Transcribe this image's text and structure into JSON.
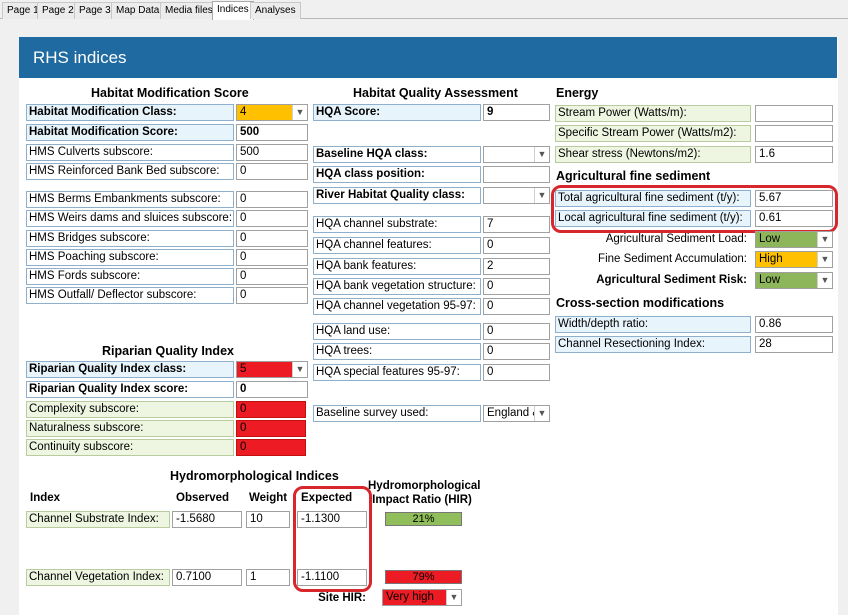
{
  "tabs": [
    "Page 1",
    "Page 2",
    "Page 3",
    "Map Data",
    "Media files",
    "Indices",
    "Analyses"
  ],
  "active_tab": "Indices",
  "header": {
    "title": "RHS indices"
  },
  "hms": {
    "title": "Habitat Modification Score",
    "class_label": "Habitat Modification Class:",
    "class_value": "4",
    "score_label": "Habitat Modification Score:",
    "score_value": "500",
    "rows": [
      {
        "label": "HMS Culverts subscore:",
        "value": "500"
      },
      {
        "label": "HMS Reinforced Bank Bed subscore:",
        "value": "0"
      },
      {
        "label": "HMS Berms Embankments subscore:",
        "value": "0"
      },
      {
        "label": "HMS Weirs dams and sluices subscore:",
        "value": "0"
      },
      {
        "label": "HMS Bridges subscore:",
        "value": "0"
      },
      {
        "label": "HMS Poaching subscore:",
        "value": "0"
      },
      {
        "label": "HMS Fords subscore:",
        "value": "0"
      },
      {
        "label": "HMS Outfall/ Deflector subscore:",
        "value": "0"
      }
    ]
  },
  "rqi": {
    "title": "Riparian Quality Index",
    "class_label": "Riparian Quality Index class:",
    "class_value": "5",
    "score_label": "Riparian Quality Index score:",
    "score_value": "0",
    "rows": [
      {
        "label": "Complexity subscore:",
        "value": "0"
      },
      {
        "label": "Naturalness subscore:",
        "value": "0"
      },
      {
        "label": "Continuity subscore:",
        "value": "0"
      }
    ]
  },
  "hqa": {
    "title": "Habitat Quality Assessment",
    "score_label": "HQA Score:",
    "score_value": "9",
    "baseline_class_label": "Baseline HQA class:",
    "class_position_label": "HQA class position:",
    "river_class_label": "River Habitat Quality class:",
    "rows": [
      {
        "label": "HQA channel substrate:",
        "value": "7"
      },
      {
        "label": "HQA channel features:",
        "value": "0"
      },
      {
        "label": "HQA bank features:",
        "value": "2"
      },
      {
        "label": "HQA bank vegetation structure:",
        "value": "0"
      },
      {
        "label": "HQA channel vegetation 95-97:",
        "value": "0"
      },
      {
        "label": "HQA land use:",
        "value": "0"
      },
      {
        "label": "HQA trees:",
        "value": "0"
      },
      {
        "label": "HQA special features 95-97:",
        "value": "0"
      }
    ],
    "baseline_survey_label": "Baseline survey used:",
    "baseline_survey_value": "England &"
  },
  "energy": {
    "title": "Energy",
    "rows": [
      {
        "label": "Stream Power (Watts/m):",
        "value": ""
      },
      {
        "label": "Specific Stream Power (Watts/m2):",
        "value": ""
      },
      {
        "label": "Shear stress (Newtons/m2):",
        "value": "1.6"
      }
    ]
  },
  "sediment": {
    "title": "Agricultural fine sediment",
    "total_label": "Total agricultural fine sediment (t/y):",
    "total_value": "5.67",
    "local_label": "Local agricultural fine sediment (t/y):",
    "local_value": "0.61",
    "load_label": "Agricultural Sediment Load:",
    "load_value": "Low",
    "accum_label": "Fine Sediment Accumulation:",
    "accum_value": "High",
    "risk_label": "Agricultural Sediment Risk:",
    "risk_value": "Low"
  },
  "xsec": {
    "title": "Cross-section modifications",
    "wd_label": "Width/depth ratio:",
    "wd_value": "0.86",
    "cri_label": "Channel Resectioning Index:",
    "cri_value": "28"
  },
  "hydro": {
    "title": "Hydromorphological Indices",
    "col_index": "Index",
    "col_observed": "Observed",
    "col_weight": "Weight",
    "col_expected": "Expected",
    "col_hir": "Hydromorphological Impact Ratio (HIR)",
    "rows": [
      {
        "label": "Channel Substrate Index:",
        "observed": "-1.5680",
        "weight": "10",
        "expected": "-1.1300",
        "hir": "21%"
      },
      {
        "label": "Channel Vegetation Index:",
        "observed": "0.7100",
        "weight": "1",
        "expected": "-1.1100",
        "hir": "79%"
      }
    ],
    "site_hir_label": "Site HIR:",
    "site_hir_value": "Very high"
  },
  "colors": {
    "header": "#1f6aa0",
    "orange": "#ffc000",
    "red": "#ed1c24",
    "green": "#8db55a",
    "highlight": "#d8262d"
  }
}
